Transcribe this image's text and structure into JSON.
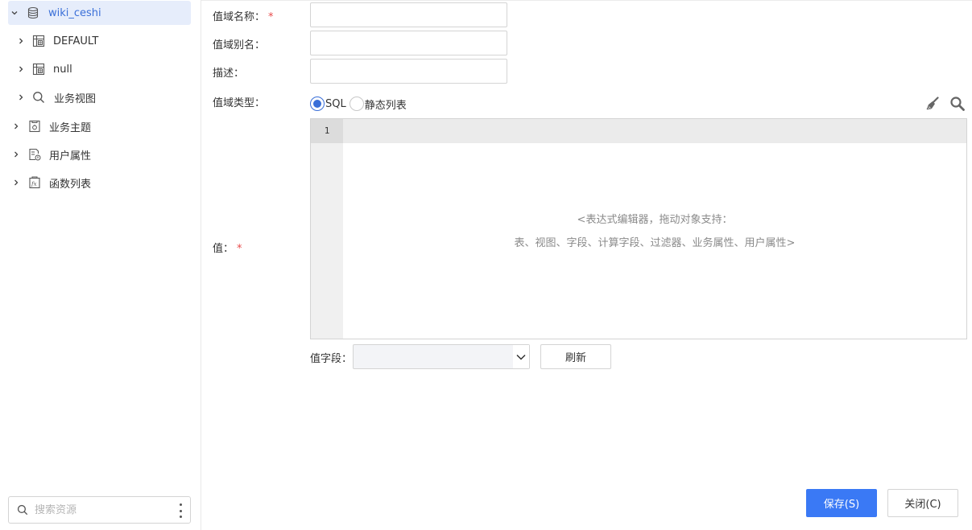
{
  "sidebar": {
    "tree": [
      {
        "label": "wiki_ceshi",
        "icon": "database-icon",
        "expanded": true,
        "selected": true
      },
      {
        "label": "DEFAULT",
        "icon": "schema-table-icon"
      },
      {
        "label": "null",
        "icon": "schema-table-icon"
      },
      {
        "label": "业务视图",
        "icon": "search-icon"
      },
      {
        "label": "业务主题",
        "icon": "business-theme-icon"
      },
      {
        "label": "用户属性",
        "icon": "user-attribute-icon"
      },
      {
        "label": "函数列表",
        "icon": "function-icon"
      }
    ],
    "search_placeholder": "搜索资源"
  },
  "form": {
    "name_label": "值域名称：",
    "alias_label": "值域别名：",
    "desc_label": "描述：",
    "type_label": "值域类型：",
    "value_label": "值：",
    "required_mark": "*",
    "name_value": "",
    "alias_value": "",
    "desc_value": "",
    "type_options": [
      {
        "label": "SQL",
        "checked": true
      },
      {
        "label": "静态列表",
        "checked": false
      }
    ],
    "editor": {
      "line_number": "1",
      "hint_line1": "<表达式编辑器，拖动对象支持：",
      "hint_line2": "表、视图、字段、计算字段、过滤器、业务属性、用户属性>"
    },
    "field_label": "值字段：",
    "field_value": "",
    "refresh_label": "刷新"
  },
  "footer": {
    "save_label": "保存(S)",
    "close_label": "关闭(C)"
  },
  "colors": {
    "accent": "#3a79f5",
    "selected_bg": "#e6edfb",
    "required": "#e84b4b"
  }
}
